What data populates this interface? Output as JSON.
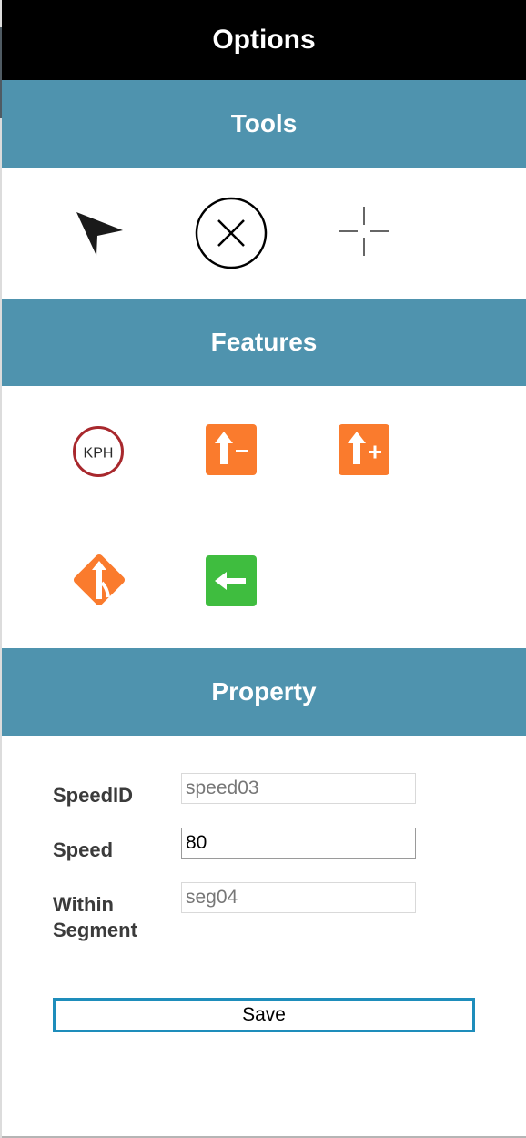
{
  "header": {
    "title": "Options"
  },
  "tools": {
    "title": "Tools",
    "items": [
      {
        "icon": "pointer-arrow-icon"
      },
      {
        "icon": "circle-x-delete-icon"
      },
      {
        "icon": "crosshair-icon"
      }
    ]
  },
  "features": {
    "title": "Features",
    "kph_label": "KPH",
    "colors": {
      "speed_ring": "#a8282d",
      "orange": "#fa7b2d",
      "green": "#3fbd3f"
    },
    "items": [
      {
        "icon": "speed-limit-kph-icon"
      },
      {
        "icon": "lane-decrease-icon"
      },
      {
        "icon": "lane-increase-icon"
      },
      {
        "icon": "merge-sign-icon"
      },
      {
        "icon": "left-arrow-icon"
      }
    ]
  },
  "property": {
    "title": "Property",
    "fields": [
      {
        "label": "SpeedID",
        "value": "speed03"
      },
      {
        "label": "Speed",
        "value": "80"
      },
      {
        "label": "Within Segment",
        "value": "seg04"
      }
    ],
    "save_label": "Save"
  },
  "colors": {
    "header_bg": "#000000",
    "section_bg": "#4f93ae",
    "save_border": "#1e8dbb"
  }
}
